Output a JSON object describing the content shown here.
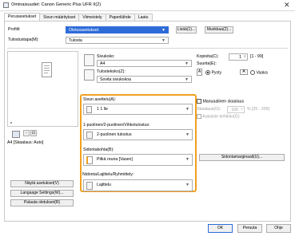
{
  "window": {
    "title": "Ominaisuudet: Canon Generic Plus UFR II(2)",
    "close": "✕"
  },
  "tabs": [
    "Perusasetukset",
    "Sivun määritykset",
    "Viimeistely",
    "Paperilähde",
    "Laatu"
  ],
  "profile": {
    "label": "Profiili:",
    "value": "Oletusasetukset",
    "add": "Lisää(1)...",
    "edit": "Muokkaa(2)..."
  },
  "output": {
    "label": "Tulostustapa(M):",
    "value": "Tulosta"
  },
  "paper_size": {
    "label": "Sivukoko:",
    "value": "A4"
  },
  "output_size": {
    "label": "Tulostekoko(Z):",
    "value": "Sovita sivukokoa"
  },
  "copies": {
    "label": "Kopioita(C):",
    "value": "1",
    "range": "[1 - 99]"
  },
  "orientation": {
    "label": "Suunta(E):",
    "portrait": "Pysty",
    "landscape": "Vaaka"
  },
  "page_layout": {
    "label": "Sivun asettelu(A):",
    "value": "1 1 lle"
  },
  "manual_scaling": {
    "label": "Manuaalinen skaalaus",
    "scale_label": "Skaalaus(G):",
    "scale_value": "100",
    "range": "% [25 - 200]"
  },
  "frame": {
    "label": "Aukaiste kehikko(G)"
  },
  "duplex": {
    "label": "1-puolinen/2-puolinen/Vihkotulostus:",
    "value": "2-puolinen tulostus"
  },
  "binding": {
    "label": "Sidontakohta(B):",
    "value": "Pitkä reuna [Vasen]",
    "margin": "Sidontamarginaali(U)..."
  },
  "finishing": {
    "label": "Nidonta/Lajittelu/Ryhmittely:",
    "value": "Lajittelu"
  },
  "preview": {
    "caption": "A4 [Skaalaus: Auto]"
  },
  "side_buttons": {
    "show": "Näytä asetukset(V)",
    "language": "Language Settings(W)...",
    "restore": "Palauta oletukset(R)"
  },
  "footer": {
    "ok": "OK",
    "cancel": "Peruuta",
    "help": "Ohje"
  }
}
